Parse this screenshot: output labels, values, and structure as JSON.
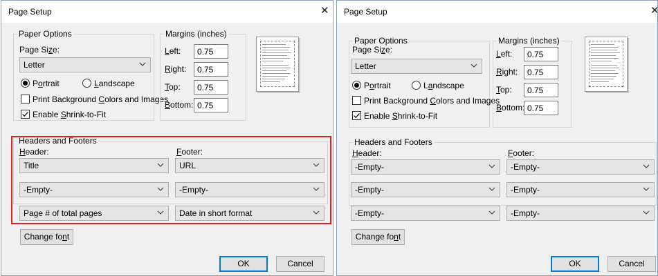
{
  "dialogs": [
    {
      "title": "Page Setup",
      "close_glyph": "✕",
      "paper_options": {
        "legend": "Paper Options",
        "page_size_label": "Page Size:",
        "page_size_value": "Letter",
        "portrait_label": "Portrait",
        "landscape_label": "Landscape",
        "orientation": "portrait",
        "print_background_label": "Print Background Colors and Images",
        "print_background_checked": false,
        "shrink_label": "Enable Shrink-to-Fit",
        "shrink_checked": true
      },
      "margins": {
        "legend": "Margins (inches)",
        "left_label": "Left:",
        "left_value": "0.75",
        "right_label": "Right:",
        "right_value": "0.75",
        "top_label": "Top:",
        "top_value": "0.75",
        "bottom_label": "Bottom:",
        "bottom_value": "0.75"
      },
      "headers_footers": {
        "legend": "Headers and Footers",
        "header_label": "Header:",
        "footer_label": "Footer:",
        "header_values": [
          "Title",
          "-Empty-",
          "Page # of total pages"
        ],
        "footer_values": [
          "URL",
          "-Empty-",
          "Date in short format"
        ],
        "highlighted": true
      },
      "change_font_label": "Change font",
      "ok_label": "OK",
      "cancel_label": "Cancel"
    },
    {
      "title": "Page Setup",
      "close_glyph": "✕",
      "paper_options": {
        "legend": "Paper Options",
        "page_size_label": "Page Size:",
        "page_size_value": "Letter",
        "portrait_label": "Portrait",
        "landscape_label": "Landscape",
        "orientation": "portrait",
        "print_background_label": "Print Background Colors and Images",
        "print_background_checked": false,
        "shrink_label": "Enable Shrink-to-Fit",
        "shrink_checked": true
      },
      "margins": {
        "legend": "Margins (inches)",
        "left_label": "Left:",
        "left_value": "0.75",
        "right_label": "Right:",
        "right_value": "0.75",
        "top_label": "Top:",
        "top_value": "0.75",
        "bottom_label": "Bottom:",
        "bottom_value": "0.75"
      },
      "headers_footers": {
        "legend": "Headers and Footers",
        "header_label": "Header:",
        "footer_label": "Footer:",
        "header_values": [
          "-Empty-",
          "-Empty-",
          "-Empty-"
        ],
        "footer_values": [
          "-Empty-",
          "-Empty-",
          "-Empty-"
        ],
        "highlighted": false
      },
      "change_font_label": "Change font",
      "ok_label": "OK",
      "cancel_label": "Cancel"
    }
  ],
  "colors": {
    "highlight": "#e02020",
    "default_button_border": "#0078d7",
    "dialog_bg": "#f0f0f0"
  }
}
